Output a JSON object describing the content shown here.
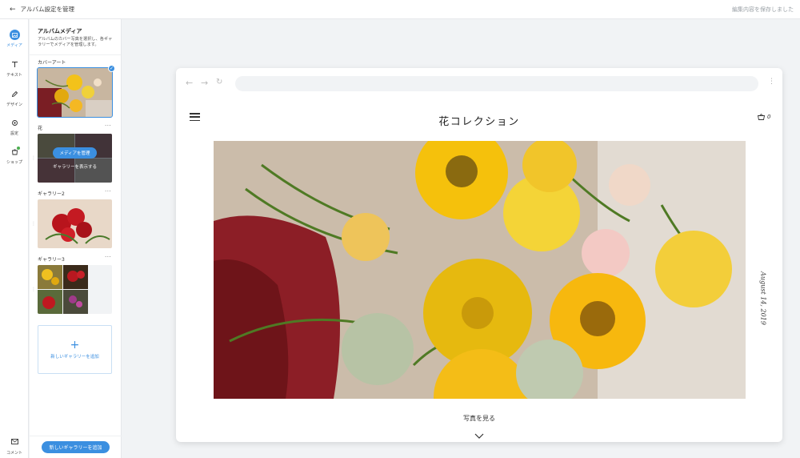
{
  "topbar": {
    "back_label": "アルバム設定を管理",
    "saved_label": "編集内容を保存しました"
  },
  "rail": {
    "items": [
      {
        "label": "メディア",
        "icon": "image-icon",
        "active": true
      },
      {
        "label": "テキスト",
        "icon": "text-icon"
      },
      {
        "label": "デザイン",
        "icon": "pen-icon"
      },
      {
        "label": "設定",
        "icon": "gear-icon"
      },
      {
        "label": "ショップ",
        "icon": "bag-icon"
      }
    ],
    "comment_label": "コメント"
  },
  "panel": {
    "title": "アルバムメディア",
    "description": "アルバムのカバー写真を選択し、各ギャラリーでメディアを管理します。",
    "cover_label": "カバーアート",
    "galleries": [
      {
        "name": "花",
        "manage_label": "メディアを管理",
        "show_label": "ギャラリーを表示する"
      },
      {
        "name": "ギャラリー2"
      },
      {
        "name": "ギャラリー3"
      }
    ],
    "add_gallery_card_label": "新しいギャラリーを追加",
    "add_gallery_button": "新しいギャラリーを追加"
  },
  "preview": {
    "site_title": "花コレクション",
    "cart_count": "0",
    "date": "August 14, 2019",
    "see_photos": "写真を見る"
  },
  "colors": {
    "accent": "#3b8fe0"
  }
}
